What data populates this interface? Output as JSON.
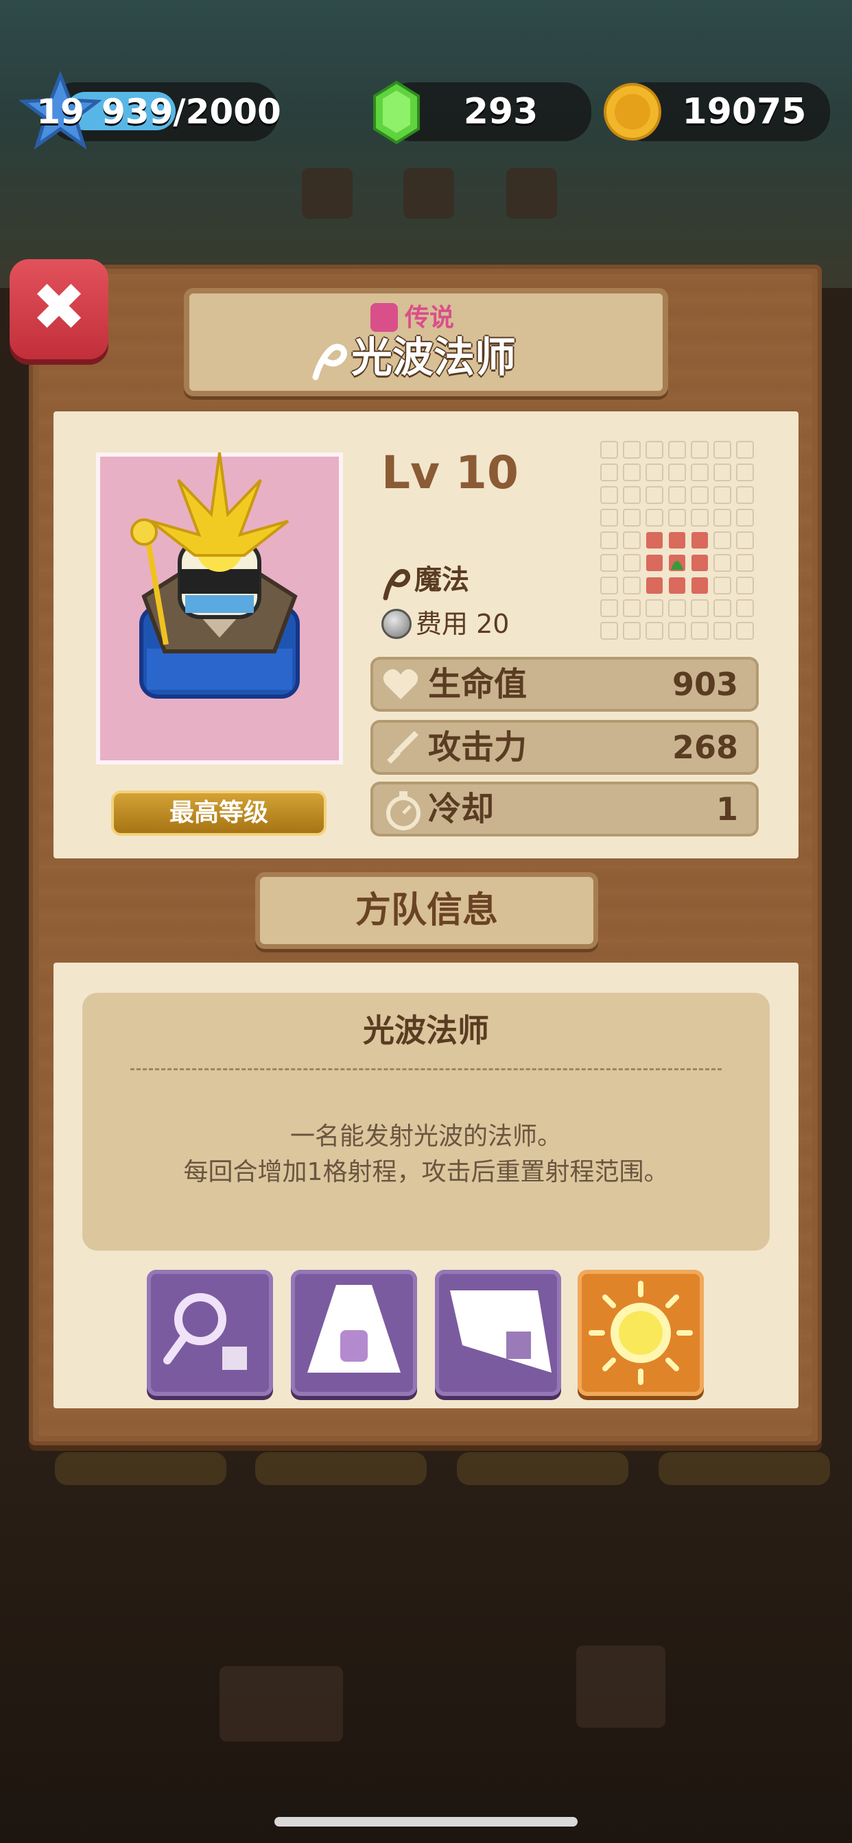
{
  "hud": {
    "level": "19",
    "xp": "939/2000",
    "gems": "293",
    "coins": "19075"
  },
  "card": {
    "rarity_label": "传说",
    "name": "光波法师",
    "level": "Lv 10",
    "type": "魔法",
    "cost_label": "费用 20",
    "max_level_label": "最高等级",
    "stats": [
      {
        "label": "生命值",
        "value": "903"
      },
      {
        "label": "攻击力",
        "value": "268"
      },
      {
        "label": "冷却",
        "value": "1"
      }
    ]
  },
  "squad": {
    "section_title": "方队信息",
    "desc_title": "光波法师",
    "desc_line1": "一名能发射光波的法师。",
    "desc_line2": "每回合增加1格射程，攻击后重置射程范围。"
  },
  "skills": [
    {
      "icon": "magnifier-wand-icon",
      "color": "#7b5b9f"
    },
    {
      "icon": "light-beam-icon",
      "color": "#7b5b9f"
    },
    {
      "icon": "diagonal-beam-icon",
      "color": "#7b5b9f"
    },
    {
      "icon": "sun-icon",
      "color": "#e0842a"
    }
  ],
  "colors": {
    "accent_brown": "#5a3c22",
    "panel": "#8a5b34",
    "paper": "#f2e6cd",
    "close_red": "#d03f4a",
    "range_red": "#d96a5c",
    "range_green": "#3a9a3a"
  }
}
